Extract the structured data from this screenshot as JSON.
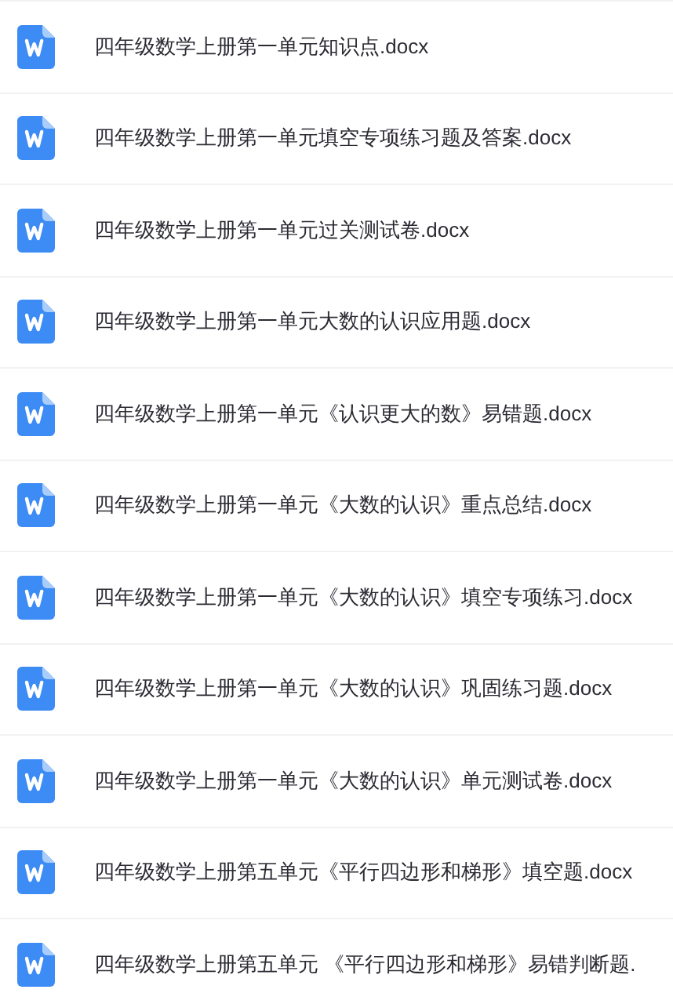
{
  "files": [
    {
      "name": "四年级数学上册第一单元知识点.docx"
    },
    {
      "name": "四年级数学上册第一单元填空专项练习题及答案.docx"
    },
    {
      "name": "四年级数学上册第一单元过关测试卷.docx"
    },
    {
      "name": "四年级数学上册第一单元大数的认识应用题.docx"
    },
    {
      "name": "四年级数学上册第一单元《认识更大的数》易错题.docx"
    },
    {
      "name": "四年级数学上册第一单元《大数的认识》重点总结.docx"
    },
    {
      "name": "四年级数学上册第一单元《大数的认识》填空专项练习.docx"
    },
    {
      "name": "四年级数学上册第一单元《大数的认识》巩固练习题.docx"
    },
    {
      "name": "四年级数学上册第一单元《大数的认识》单元测试卷.docx"
    },
    {
      "name": "四年级数学上册第五单元《平行四边形和梯形》填空题.docx"
    },
    {
      "name": "四年级数学上册第五单元 《平行四边形和梯形》易错判断题."
    }
  ]
}
